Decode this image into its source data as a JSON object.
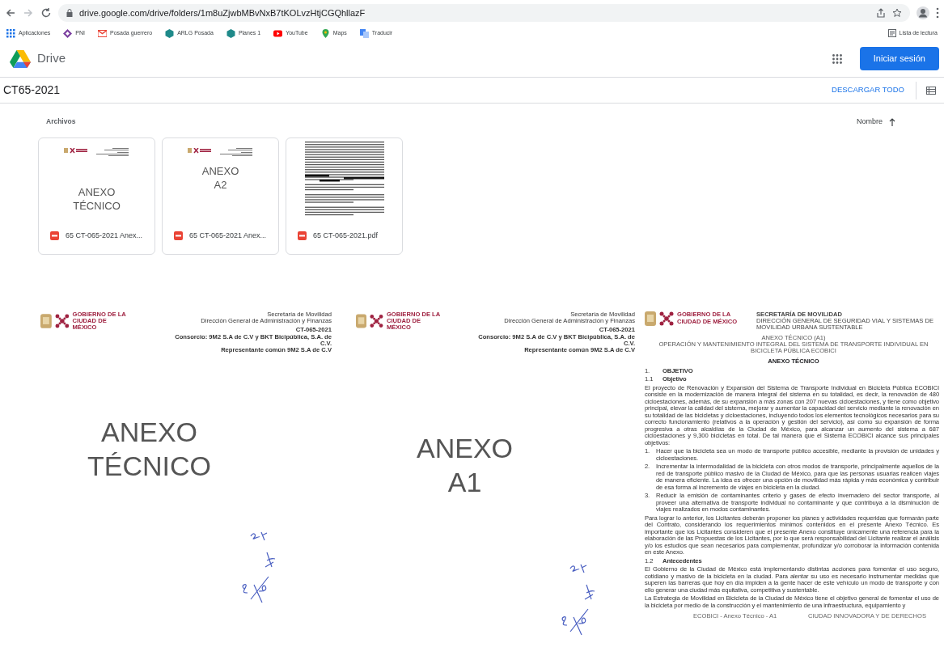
{
  "browser": {
    "url": "drive.google.com/drive/folders/1m8uZjwbMBvNxB7tKOLvzHtjCGQhllazF",
    "bookmarks": [
      {
        "kind": "apps",
        "label": "Aplicaciones"
      },
      {
        "kind": "diamond",
        "label": "PNI"
      },
      {
        "kind": "mail",
        "label": "Posada guerrero"
      },
      {
        "kind": "hex",
        "label": "ARLG Posada"
      },
      {
        "kind": "hex",
        "label": "Planes 1"
      },
      {
        "kind": "video",
        "label": "YouTube"
      },
      {
        "kind": "pin",
        "label": "Maps"
      },
      {
        "kind": "translate",
        "label": "Traducir"
      }
    ],
    "reading_list": "Lista de lectura"
  },
  "drive": {
    "brand": "Drive",
    "sign_in": "Iniciar sesión",
    "folder": "CT65-2021",
    "download_all": "DESCARGAR TODO",
    "section": "Archivos",
    "sort": {
      "label": "Nombre",
      "ascending": true
    },
    "files": [
      {
        "name": "65 CT-065-2021 Anex...",
        "thumb": {
          "kind": "cover",
          "lines": [
            "ANEXO",
            "TÉCNICO"
          ]
        }
      },
      {
        "name": "65 CT-065-2021 Anex...",
        "thumb": {
          "kind": "cover",
          "lines": [
            "ANEXO",
            "A2"
          ]
        }
      },
      {
        "name": "65 CT-065-2021.pdf",
        "thumb": {
          "kind": "text"
        }
      }
    ]
  },
  "preview_pages": [
    {
      "kind": "cover",
      "logo_lines": [
        "GOBIERNO DE LA",
        "CIUDAD DE MÉXICO"
      ],
      "right_lines": [
        "Secretaría de Movilidad",
        "Dirección General de Administración y Finanzas"
      ],
      "ref_lines": [
        "CT-065-2021",
        "Consorcio: 9M2 S.A de C.V y BKT Bicipública, S.A. de C.V.",
        "Representante común 9M2 S.A de C.V"
      ],
      "title_lines": [
        "ANEXO",
        "TÉCNICO"
      ]
    },
    {
      "kind": "cover",
      "logo_lines": [
        "GOBIERNO DE LA",
        "CIUDAD DE MÉXICO"
      ],
      "right_lines": [
        "Secretaría de Movilidad",
        "Dirección General de Administración y Finanzas"
      ],
      "ref_lines": [
        "CT-065-2021",
        "Consorcio: 9M2 S.A de C.V y BKT Bicipública, S.A. de C.V.",
        "Representante común 9M2 S.A de C.V"
      ],
      "title_lines": [
        "ANEXO",
        "A1"
      ]
    },
    {
      "kind": "document",
      "logo_lines": [
        "GOBIERNO DE LA",
        "CIUDAD DE MÉXICO"
      ],
      "right_lines": [
        "SECRETARÍA DE MOVILIDAD",
        "DIRECCIÓN GENERAL DE SEGURIDAD VIAL Y SISTEMAS DE MOVILIDAD URBANA SUSTENTABLE"
      ],
      "subtitle_lines": [
        "ANEXO TÉCNICO (A1)",
        "OPERACIÓN Y MANTENIMIENTO INTEGRAL DEL SISTEMA DE TRANSPORTE INDIVIDUAL EN BICICLETA PÚBLICA ECOBICI"
      ],
      "title": "ANEXO TÉCNICO",
      "blocks": [
        {
          "kind": "heading",
          "number": "1.",
          "text": "OBJETIVO"
        },
        {
          "kind": "subheading",
          "number": "1.1",
          "text": "Objetivo"
        },
        {
          "kind": "paragraph",
          "text": "El proyecto de Renovación y Expansión del Sistema de Transporte Individual en Bicicleta Pública ECOBICI consiste en la modernización de manera integral del sistema en su totalidad, es decir, la renovación de 480 cicloestaciones, además, de su expansión a más zonas con 207 nuevas cicloestaciones, y tiene como objetivo principal, elevar la calidad del sistema, mejorar y aumentar la capacidad del servicio mediante la renovación en su totalidad de las bicicletas y cicloestaciones, incluyendo todos los elementos tecnológicos necesarios para su correcto funcionamiento (relativos a la operación y gestión del servicio), así como su expansión de forma progresiva a otras alcaldías de la Ciudad de México, para alcanzar un aumento del sistema a 687 cicloestaciones y 9,300 bicicletas en total. De tal manera que el Sistema ECOBICI alcance sus principales objetivos:"
        },
        {
          "kind": "item",
          "number": "1.",
          "text": "Hacer que la bicicleta sea un modo de transporte público accesible, mediante la provisión de unidades y cicloestaciones."
        },
        {
          "kind": "item",
          "number": "2.",
          "text": "Incrementar la intermodalidad de la bicicleta con otros modos de transporte, principalmente aquellos de la red de transporte público masivo de la Ciudad de México, para que las personas usuarias realicen viajes de manera eficiente. La idea es ofrecer una opción de movilidad más rápida y más económica y contribuir de esa forma al incremento de viajes en bicicleta en la ciudad."
        },
        {
          "kind": "item",
          "number": "3.",
          "text": "Reducir la emisión de contaminantes criterio y gases de efecto invernadero del sector transporte, al proveer una alternativa de transporte individual no contaminante y que contribuya a la disminución de viajes realizados en modos contaminantes."
        },
        {
          "kind": "paragraph",
          "text": "Para lograr lo anterior, los Licitantes deberán proponer los planes y actividades requeridas que formarán parte del Contrato, considerando los requerimientos mínimos contenidos en el presente Anexo Técnico. Es importante que los Licitantes consideren que el presente Anexo constituye únicamente una referencia para la elaboración de las Propuestas de los Licitantes, por lo que será responsabilidad del Licitante realizar el análisis y/o los estudios que sean necesarios para complementar, profundizar y/o corroborar la información contenida en este Anexo."
        },
        {
          "kind": "subheading",
          "number": "1.2",
          "text": "Antecedentes"
        },
        {
          "kind": "paragraph",
          "text": "El Gobierno de la Ciudad de México está implementando distintas acciones para fomentar el uso seguro, cotidiano y masivo de la bicicleta en la ciudad. Para alentar su uso es necesario instrumentar medidas que superen las barreras que hoy en día impiden a la gente hacer de este vehículo un modo de transporte y con ello generar una ciudad más equitativa, competitiva y sustentable."
        },
        {
          "kind": "paragraph",
          "text": "La Estrategia de Movilidad en Bicicleta de la Ciudad de México tiene el objetivo general de fomentar el uso de la bicicleta por medio de la construcción y el mantenimiento de una infraestructura, equipamiento y"
        }
      ],
      "footer": [
        "ECOBICI - Anexo Técnico - A1",
        "CIUDAD INNOVADORA Y DE DERECHOS"
      ]
    }
  ]
}
